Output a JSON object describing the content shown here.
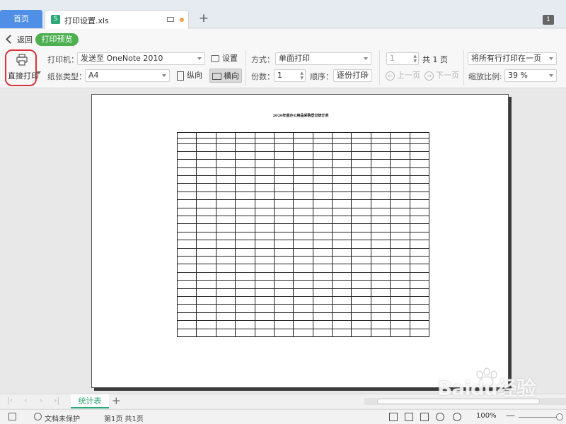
{
  "tabs": {
    "home_label": "首页",
    "file_label": "打印设置.xls",
    "file_icon": "S",
    "new_tab_label": "+",
    "count": "1"
  },
  "toolbar": {
    "back_label": "返回",
    "mode_badge": "打印预览",
    "direct_print_label": "直接打印",
    "printer_label": "打印机：",
    "printer_value": "发送至 OneNote 2010",
    "settings_label": "设置",
    "paper_type_label": "纸张类型：",
    "paper_type_value": "A4",
    "portrait_label": "纵向",
    "landscape_label": "横向",
    "method_label": "方式：",
    "method_value": "单面打印",
    "copies_label": "份数：",
    "copies_value": "1",
    "order_label": "顺序：",
    "order_value": "逐份打印",
    "page_input_value": "1",
    "total_pages": "共 1 页",
    "prev_page_label": "上一页",
    "next_page_label": "下一页",
    "fit_value": "将所有行打印在一页",
    "scale_label": "缩放比例:",
    "scale_value": "39 %"
  },
  "preview": {
    "sheet_title": "2020年度办公用品采购登记统计表"
  },
  "sheets": {
    "active_tab": "统计表",
    "add_label": "+"
  },
  "status": {
    "protection": "文档未保护",
    "page_info": "第1页 共1页",
    "zoom": "100%",
    "zoom_minus": "—"
  },
  "watermark": {
    "text": "Baidu经验"
  },
  "colors": {
    "accent_green": "#4caf50",
    "home_tab_blue": "#4f8fe6",
    "highlight_red": "#d9343a"
  }
}
